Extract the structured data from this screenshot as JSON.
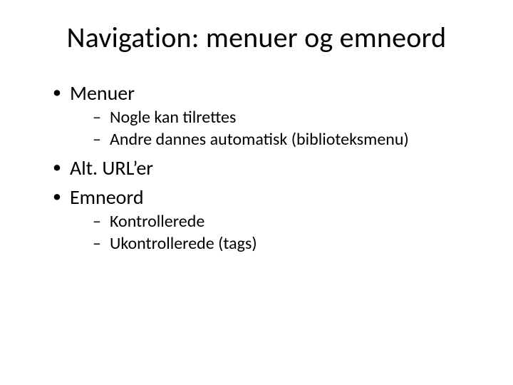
{
  "title": "Navigation: menuer og emneord",
  "bullets": {
    "item1": "Menuer",
    "item1_sub1": "Nogle kan tilrettes",
    "item1_sub2": "Andre dannes automatisk (biblioteksmenu)",
    "item2": "Alt. URL’er",
    "item3": "Emneord",
    "item3_sub1": "Kontrollerede",
    "item3_sub2": "Ukontrollerede (tags)"
  }
}
